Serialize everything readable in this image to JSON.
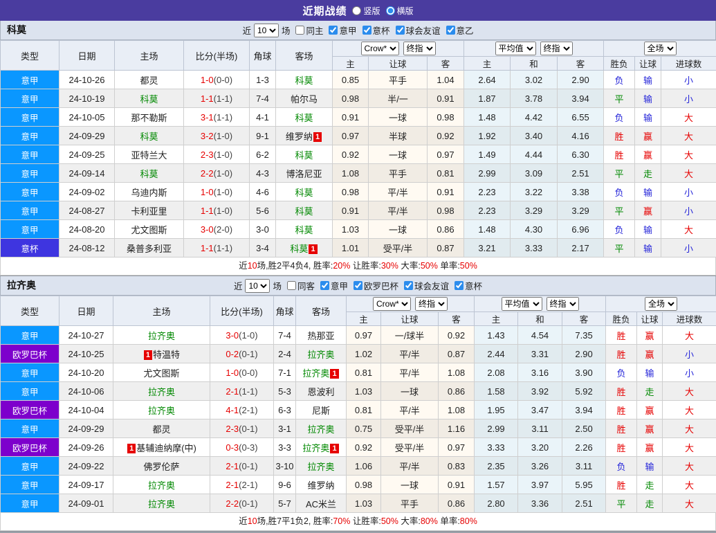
{
  "title_bar": {
    "title": "近期战绩",
    "options": [
      {
        "label": "竖版",
        "selected": false
      },
      {
        "label": "横版",
        "selected": true
      }
    ]
  },
  "table_header": {
    "plain_cols": [
      "类型",
      "日期",
      "主场",
      "比分(半场)",
      "角球",
      "客场"
    ],
    "groups": [
      {
        "selects": [
          "Crow*",
          "终指"
        ],
        "cols": [
          "主",
          "让球",
          "客"
        ]
      },
      {
        "selects": [
          "平均值",
          "终指"
        ],
        "cols": [
          "主",
          "和",
          "客"
        ]
      },
      {
        "selects": [
          "全场"
        ],
        "cols": [
          "胜负",
          "让球",
          "进球数"
        ]
      }
    ]
  },
  "league_colors": {
    "意甲": "#0a97ff",
    "意杯": "#3e35e0",
    "欧罗巴杯": "#7d00cc"
  },
  "sections": [
    {
      "team": "科莫",
      "filter": {
        "near_label": "近",
        "matches": "10",
        "unit_label": "场",
        "same": {
          "label": "同主",
          "checked": false
        },
        "leagues": [
          {
            "label": "意甲",
            "checked": true
          },
          {
            "label": "意杯",
            "checked": true
          },
          {
            "label": "球会友谊",
            "checked": true
          },
          {
            "label": "意乙",
            "checked": true
          }
        ]
      },
      "rows": [
        {
          "league": "意甲",
          "date": "24-10-26",
          "home": {
            "name": "都灵"
          },
          "ft": "1-0",
          "ht": "(0-0)",
          "corner": "1-3",
          "away": {
            "name": "科莫",
            "green": true
          },
          "ah": [
            "0.85",
            "平手",
            "1.04"
          ],
          "eu": [
            "2.64",
            "3.02",
            "2.90"
          ],
          "res": [
            {
              "t": "负",
              "c": "blue"
            },
            {
              "t": "输",
              "c": "blue"
            },
            {
              "t": "小",
              "c": "blue"
            }
          ]
        },
        {
          "league": "意甲",
          "date": "24-10-19",
          "home": {
            "name": "科莫",
            "green": true
          },
          "ft": "1-1",
          "ht": "(1-1)",
          "corner": "7-4",
          "away": {
            "name": "帕尔马"
          },
          "ah": [
            "0.98",
            "半/一",
            "0.91"
          ],
          "eu": [
            "1.87",
            "3.78",
            "3.94"
          ],
          "res": [
            {
              "t": "平",
              "c": "green"
            },
            {
              "t": "输",
              "c": "blue"
            },
            {
              "t": "小",
              "c": "blue"
            }
          ]
        },
        {
          "league": "意甲",
          "date": "24-10-05",
          "home": {
            "name": "那不勒斯"
          },
          "ft": "3-1",
          "ht": "(1-1)",
          "corner": "4-1",
          "away": {
            "name": "科莫",
            "green": true
          },
          "ah": [
            "0.91",
            "一球",
            "0.98"
          ],
          "eu": [
            "1.48",
            "4.42",
            "6.55"
          ],
          "res": [
            {
              "t": "负",
              "c": "blue"
            },
            {
              "t": "输",
              "c": "blue"
            },
            {
              "t": "大",
              "c": "red"
            }
          ]
        },
        {
          "league": "意甲",
          "date": "24-09-29",
          "home": {
            "name": "科莫",
            "green": true
          },
          "ft": "3-2",
          "ht": "(1-0)",
          "corner": "9-1",
          "away": {
            "name": "维罗纳",
            "badge_after": "1"
          },
          "ah": [
            "0.97",
            "半球",
            "0.92"
          ],
          "eu": [
            "1.92",
            "3.40",
            "4.16"
          ],
          "res": [
            {
              "t": "胜",
              "c": "red"
            },
            {
              "t": "赢",
              "c": "red"
            },
            {
              "t": "大",
              "c": "red"
            }
          ]
        },
        {
          "league": "意甲",
          "date": "24-09-25",
          "home": {
            "name": "亚特兰大"
          },
          "ft": "2-3",
          "ht": "(1-0)",
          "corner": "6-2",
          "away": {
            "name": "科莫",
            "green": true
          },
          "ah": [
            "0.92",
            "一球",
            "0.97"
          ],
          "eu": [
            "1.49",
            "4.44",
            "6.30"
          ],
          "res": [
            {
              "t": "胜",
              "c": "red"
            },
            {
              "t": "赢",
              "c": "red"
            },
            {
              "t": "大",
              "c": "red"
            }
          ]
        },
        {
          "league": "意甲",
          "date": "24-09-14",
          "home": {
            "name": "科莫",
            "green": true
          },
          "ft": "2-2",
          "ht": "(1-0)",
          "corner": "4-3",
          "away": {
            "name": "博洛尼亚"
          },
          "ah": [
            "1.08",
            "平手",
            "0.81"
          ],
          "eu": [
            "2.99",
            "3.09",
            "2.51"
          ],
          "res": [
            {
              "t": "平",
              "c": "green"
            },
            {
              "t": "走",
              "c": "green"
            },
            {
              "t": "大",
              "c": "red"
            }
          ]
        },
        {
          "league": "意甲",
          "date": "24-09-02",
          "home": {
            "name": "乌迪内斯"
          },
          "ft": "1-0",
          "ht": "(1-0)",
          "corner": "4-6",
          "away": {
            "name": "科莫",
            "green": true
          },
          "ah": [
            "0.98",
            "平/半",
            "0.91"
          ],
          "eu": [
            "2.23",
            "3.22",
            "3.38"
          ],
          "res": [
            {
              "t": "负",
              "c": "blue"
            },
            {
              "t": "输",
              "c": "blue"
            },
            {
              "t": "小",
              "c": "blue"
            }
          ]
        },
        {
          "league": "意甲",
          "date": "24-08-27",
          "home": {
            "name": "卡利亚里"
          },
          "ft": "1-1",
          "ht": "(1-0)",
          "corner": "5-6",
          "away": {
            "name": "科莫",
            "green": true
          },
          "ah": [
            "0.91",
            "平/半",
            "0.98"
          ],
          "eu": [
            "2.23",
            "3.29",
            "3.29"
          ],
          "res": [
            {
              "t": "平",
              "c": "green"
            },
            {
              "t": "赢",
              "c": "red"
            },
            {
              "t": "小",
              "c": "blue"
            }
          ]
        },
        {
          "league": "意甲",
          "date": "24-08-20",
          "home": {
            "name": "尤文图斯"
          },
          "ft": "3-0",
          "ht": "(2-0)",
          "corner": "3-0",
          "away": {
            "name": "科莫",
            "green": true
          },
          "ah": [
            "1.03",
            "一球",
            "0.86"
          ],
          "eu": [
            "1.48",
            "4.30",
            "6.96"
          ],
          "res": [
            {
              "t": "负",
              "c": "blue"
            },
            {
              "t": "输",
              "c": "blue"
            },
            {
              "t": "大",
              "c": "red"
            }
          ]
        },
        {
          "league": "意杯",
          "date": "24-08-12",
          "home": {
            "name": "桑普多利亚"
          },
          "ft": "1-1",
          "ht": "(1-1)",
          "corner": "3-4",
          "away": {
            "name": "科莫",
            "green": true,
            "badge_after": "1"
          },
          "ah": [
            "1.01",
            "受平/半",
            "0.87"
          ],
          "eu": [
            "3.21",
            "3.33",
            "2.17"
          ],
          "res": [
            {
              "t": "平",
              "c": "green"
            },
            {
              "t": "输",
              "c": "blue"
            },
            {
              "t": "小",
              "c": "blue"
            }
          ]
        }
      ],
      "summary": [
        {
          "t": "近"
        },
        {
          "t": "10",
          "red": true
        },
        {
          "t": "场,胜2平4负4, 胜率:"
        },
        {
          "t": "20%",
          "red": true
        },
        {
          "t": " 让胜率:"
        },
        {
          "t": "30%",
          "red": true
        },
        {
          "t": " 大率:"
        },
        {
          "t": "50%",
          "red": true
        },
        {
          "t": " 单率:"
        },
        {
          "t": "50%",
          "red": true
        }
      ]
    },
    {
      "team": "拉齐奥",
      "filter": {
        "near_label": "近",
        "matches": "10",
        "unit_label": "场",
        "same": {
          "label": "同客",
          "checked": false
        },
        "leagues": [
          {
            "label": "意甲",
            "checked": true
          },
          {
            "label": "欧罗巴杯",
            "checked": true
          },
          {
            "label": "球会友谊",
            "checked": true
          },
          {
            "label": "意杯",
            "checked": true
          }
        ]
      },
      "rows": [
        {
          "league": "意甲",
          "date": "24-10-27",
          "home": {
            "name": "拉齐奥",
            "green": true
          },
          "ft": "3-0",
          "ht": "(1-0)",
          "corner": "7-4",
          "away": {
            "name": "热那亚"
          },
          "ah": [
            "0.97",
            "一/球半",
            "0.92"
          ],
          "eu": [
            "1.43",
            "4.54",
            "7.35"
          ],
          "res": [
            {
              "t": "胜",
              "c": "red"
            },
            {
              "t": "赢",
              "c": "red"
            },
            {
              "t": "大",
              "c": "red"
            }
          ]
        },
        {
          "league": "欧罗巴杯",
          "date": "24-10-25",
          "home": {
            "name": "特温特",
            "badge_before": "1"
          },
          "ft": "0-2",
          "ht": "(0-1)",
          "corner": "2-4",
          "away": {
            "name": "拉齐奥",
            "green": true
          },
          "ah": [
            "1.02",
            "平/半",
            "0.87"
          ],
          "eu": [
            "2.44",
            "3.31",
            "2.90"
          ],
          "res": [
            {
              "t": "胜",
              "c": "red"
            },
            {
              "t": "赢",
              "c": "red"
            },
            {
              "t": "小",
              "c": "blue"
            }
          ]
        },
        {
          "league": "意甲",
          "date": "24-10-20",
          "home": {
            "name": "尤文图斯"
          },
          "ft": "1-0",
          "ht": "(0-0)",
          "corner": "7-1",
          "away": {
            "name": "拉齐奥",
            "green": true,
            "badge_after": "1"
          },
          "ah": [
            "0.81",
            "平/半",
            "1.08"
          ],
          "eu": [
            "2.08",
            "3.16",
            "3.90"
          ],
          "res": [
            {
              "t": "负",
              "c": "blue"
            },
            {
              "t": "输",
              "c": "blue"
            },
            {
              "t": "小",
              "c": "blue"
            }
          ]
        },
        {
          "league": "意甲",
          "date": "24-10-06",
          "home": {
            "name": "拉齐奥",
            "green": true
          },
          "ft": "2-1",
          "ht": "(1-1)",
          "corner": "5-3",
          "away": {
            "name": "恩波利"
          },
          "ah": [
            "1.03",
            "一球",
            "0.86"
          ],
          "eu": [
            "1.58",
            "3.92",
            "5.92"
          ],
          "res": [
            {
              "t": "胜",
              "c": "red"
            },
            {
              "t": "走",
              "c": "green"
            },
            {
              "t": "大",
              "c": "red"
            }
          ]
        },
        {
          "league": "欧罗巴杯",
          "date": "24-10-04",
          "home": {
            "name": "拉齐奥",
            "green": true
          },
          "ft": "4-1",
          "ht": "(2-1)",
          "corner": "6-3",
          "away": {
            "name": "尼斯"
          },
          "ah": [
            "0.81",
            "平/半",
            "1.08"
          ],
          "eu": [
            "1.95",
            "3.47",
            "3.94"
          ],
          "res": [
            {
              "t": "胜",
              "c": "red"
            },
            {
              "t": "赢",
              "c": "red"
            },
            {
              "t": "大",
              "c": "red"
            }
          ]
        },
        {
          "league": "意甲",
          "date": "24-09-29",
          "home": {
            "name": "都灵"
          },
          "ft": "2-3",
          "ht": "(0-1)",
          "corner": "3-1",
          "away": {
            "name": "拉齐奥",
            "green": true
          },
          "ah": [
            "0.75",
            "受平/半",
            "1.16"
          ],
          "eu": [
            "2.99",
            "3.11",
            "2.50"
          ],
          "res": [
            {
              "t": "胜",
              "c": "red"
            },
            {
              "t": "赢",
              "c": "red"
            },
            {
              "t": "大",
              "c": "red"
            }
          ]
        },
        {
          "league": "欧罗巴杯",
          "date": "24-09-26",
          "home": {
            "name": "基辅迪纳摩(中)",
            "badge_before": "1"
          },
          "ft": "0-3",
          "ht": "(0-3)",
          "corner": "3-3",
          "away": {
            "name": "拉齐奥",
            "green": true,
            "badge_after": "1"
          },
          "ah": [
            "0.92",
            "受平/半",
            "0.97"
          ],
          "eu": [
            "3.33",
            "3.20",
            "2.26"
          ],
          "res": [
            {
              "t": "胜",
              "c": "red"
            },
            {
              "t": "赢",
              "c": "red"
            },
            {
              "t": "大",
              "c": "red"
            }
          ]
        },
        {
          "league": "意甲",
          "date": "24-09-22",
          "home": {
            "name": "佛罗伦萨"
          },
          "ft": "2-1",
          "ht": "(0-1)",
          "corner": "3-10",
          "away": {
            "name": "拉齐奥",
            "green": true
          },
          "ah": [
            "1.06",
            "平/半",
            "0.83"
          ],
          "eu": [
            "2.35",
            "3.26",
            "3.11"
          ],
          "res": [
            {
              "t": "负",
              "c": "blue"
            },
            {
              "t": "输",
              "c": "blue"
            },
            {
              "t": "大",
              "c": "red"
            }
          ]
        },
        {
          "league": "意甲",
          "date": "24-09-17",
          "home": {
            "name": "拉齐奥",
            "green": true
          },
          "ft": "2-1",
          "ht": "(2-1)",
          "corner": "9-6",
          "away": {
            "name": "维罗纳"
          },
          "ah": [
            "0.98",
            "一球",
            "0.91"
          ],
          "eu": [
            "1.57",
            "3.97",
            "5.95"
          ],
          "res": [
            {
              "t": "胜",
              "c": "red"
            },
            {
              "t": "走",
              "c": "green"
            },
            {
              "t": "大",
              "c": "red"
            }
          ]
        },
        {
          "league": "意甲",
          "date": "24-09-01",
          "home": {
            "name": "拉齐奥",
            "green": true
          },
          "ft": "2-2",
          "ht": "(0-1)",
          "corner": "5-7",
          "away": {
            "name": "AC米兰"
          },
          "ah": [
            "1.03",
            "平手",
            "0.86"
          ],
          "eu": [
            "2.80",
            "3.36",
            "2.51"
          ],
          "res": [
            {
              "t": "平",
              "c": "green"
            },
            {
              "t": "走",
              "c": "green"
            },
            {
              "t": "大",
              "c": "red"
            }
          ]
        }
      ],
      "summary": [
        {
          "t": "近"
        },
        {
          "t": "10",
          "red": true
        },
        {
          "t": "场,胜7平1负2, 胜率:"
        },
        {
          "t": "70%",
          "red": true
        },
        {
          "t": " 让胜率:"
        },
        {
          "t": "50%",
          "red": true
        },
        {
          "t": " 大率:"
        },
        {
          "t": "80%",
          "red": true
        },
        {
          "t": " 单率:"
        },
        {
          "t": "80%",
          "red": true
        }
      ]
    }
  ]
}
